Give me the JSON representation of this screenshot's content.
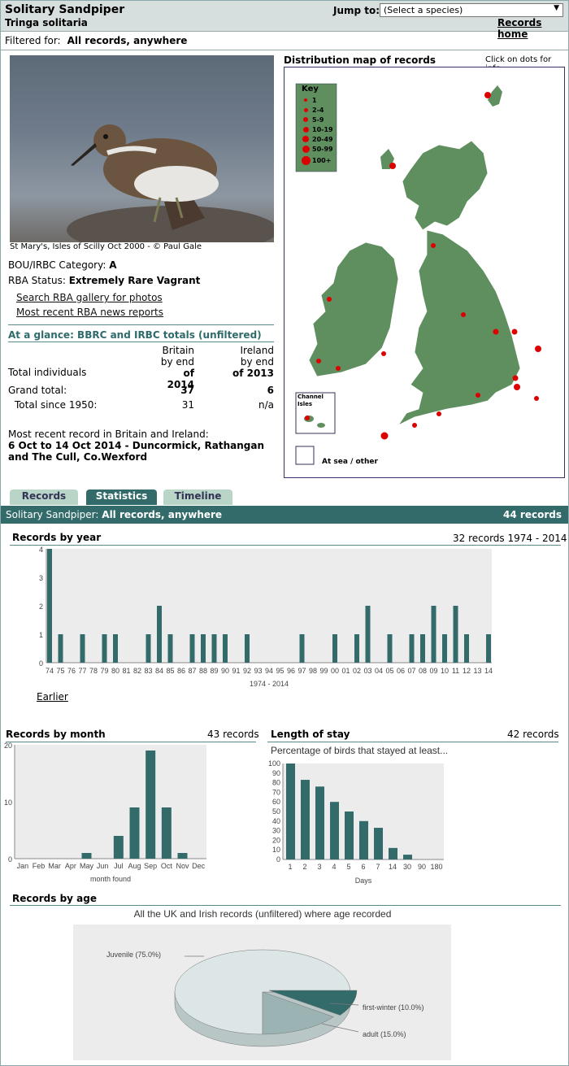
{
  "header": {
    "title": "Solitary Sandpiper",
    "latin": "Tringa solitaria",
    "jump_label": "Jump to:",
    "select_value": "(Select a species)",
    "records_home": "Records home"
  },
  "filter": {
    "label": "Filtered for:",
    "value": "All records, anywhere"
  },
  "photo": {
    "caption": "St Mary's, Isles of Scilly Oct 2000 - © Paul Gale"
  },
  "info": {
    "category_label": "BOU/IRBC Category:",
    "category_value": "A",
    "status_label": "RBA Status:",
    "status_value": "Extremely Rare Vagrant",
    "link_gallery": "Search RBA gallery for photos",
    "link_news": "Most recent RBA news reports"
  },
  "glance": {
    "title": "At a glance: BBRC and IRBC totals (unfiltered)",
    "col_britain": [
      "Britain",
      "by end",
      "of 2014"
    ],
    "col_ireland": [
      "Ireland",
      "by end",
      "of 2013"
    ],
    "total_individuals": "Total individuals",
    "grand_label": "Grand total:",
    "grand_britain": "37",
    "grand_ireland": "6",
    "since_label": "Total since 1950:",
    "since_britain": "31",
    "since_ireland": "n/a",
    "recent_label": "Most recent record in Britain and Ireland:",
    "recent_value": "6 Oct to 14 Oct 2014 - Duncormick, Rathangan and The Cull, Co.Wexford"
  },
  "map": {
    "title": "Distribution map of records",
    "hint": "Click on dots for info",
    "key_title": "Key",
    "key_items": [
      "1",
      "2-4",
      "5-9",
      "10-19",
      "20-49",
      "50-99",
      "100+"
    ],
    "channel": "Channel Isles",
    "at_sea": "At sea / other"
  },
  "tabs": {
    "records": "Records",
    "statistics": "Statistics",
    "timeline": "Timeline"
  },
  "bar": {
    "species": "Solitary Sandpiper:",
    "filter": "All records, anywhere",
    "count": "44 records"
  },
  "year_chart": {
    "title": "Records by year",
    "summary": "32 records 1974 - 2014",
    "xlabel": "1974 - 2014",
    "earlier": "Earlier"
  },
  "month_chart": {
    "title": "Records by month",
    "summary": "43 records",
    "xlabel": "month found"
  },
  "stay_chart": {
    "title": "Length of stay",
    "summary": "42 records",
    "subtitle": "Percentage of birds that stayed at least...",
    "xlabel": "Days"
  },
  "age_chart": {
    "title": "Records by age",
    "subtitle": "All the UK and Irish records (unfiltered) where age recorded"
  },
  "colors": {
    "bar": "#336b6b",
    "header": "#d6dede",
    "accent": "#2f6b6b",
    "land": "#5f8f5f",
    "dot": "#dd0000"
  },
  "chart_data": [
    {
      "type": "bar",
      "title": "Records by year",
      "categories": [
        "74",
        "75",
        "76",
        "77",
        "78",
        "79",
        "80",
        "81",
        "82",
        "83",
        "84",
        "85",
        "86",
        "87",
        "88",
        "89",
        "90",
        "91",
        "92",
        "93",
        "94",
        "95",
        "96",
        "97",
        "98",
        "99",
        "00",
        "01",
        "02",
        "03",
        "04",
        "05",
        "06",
        "07",
        "08",
        "09",
        "10",
        "11",
        "12",
        "13",
        "14"
      ],
      "values": [
        4,
        1,
        0,
        1,
        0,
        1,
        1,
        0,
        0,
        1,
        2,
        1,
        0,
        1,
        1,
        1,
        1,
        0,
        1,
        0,
        0,
        0,
        0,
        1,
        0,
        0,
        1,
        0,
        1,
        2,
        0,
        1,
        0,
        1,
        1,
        2,
        1,
        2,
        1,
        0,
        1
      ],
      "ylim": [
        0,
        4
      ],
      "xlabel": "1974 - 2014"
    },
    {
      "type": "bar",
      "title": "Records by month",
      "categories": [
        "Jan",
        "Feb",
        "Mar",
        "Apr",
        "May",
        "Jun",
        "Jul",
        "Aug",
        "Sep",
        "Oct",
        "Nov",
        "Dec"
      ],
      "values": [
        0,
        0,
        0,
        0,
        1,
        0,
        4,
        9,
        19,
        9,
        1,
        0
      ],
      "ylim": [
        0,
        20
      ],
      "yticks": [
        0,
        10,
        20
      ],
      "xlabel": "month found"
    },
    {
      "type": "bar",
      "title": "Length of stay",
      "categories": [
        "1",
        "2",
        "3",
        "4",
        "5",
        "6",
        "7",
        "14",
        "30",
        "90",
        "180"
      ],
      "values": [
        100,
        83,
        76,
        60,
        50,
        40,
        33,
        12,
        5,
        0,
        0
      ],
      "ylim": [
        0,
        100
      ],
      "xlabel": "Days"
    },
    {
      "type": "pie",
      "title": "Records by age",
      "labels": [
        "Juvenile (75.0%)",
        "first-winter (10.0%)",
        "adult (15.0%)"
      ],
      "values": [
        75,
        10,
        15
      ]
    }
  ]
}
